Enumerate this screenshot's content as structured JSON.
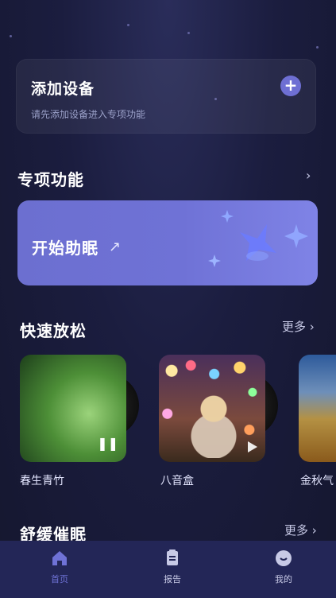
{
  "colors": {
    "background": "#1b1d3f",
    "accent": "#6e6fd3",
    "tabbar": "#232657",
    "tab_active": "#6f72d6",
    "tab_inactive": "#c7c9e6"
  },
  "device_card": {
    "title": "添加设备",
    "subtitle": "请先添加设备进入专项功能",
    "plus_icon": "plus-icon"
  },
  "special": {
    "title": "专项功能",
    "chevron_icon": "chevron-right-icon",
    "banner": {
      "label": "开始助眠",
      "arrow_icon": "arrow-right-icon"
    }
  },
  "quick_relax": {
    "title": "快速放松",
    "more": "更多 ›",
    "items": [
      {
        "name": "春生青竹",
        "control_icon": "pause-icon"
      },
      {
        "name": "八音盒",
        "control_icon": "play-icon"
      },
      {
        "name": "金秋气",
        "control_icon": ""
      }
    ]
  },
  "hypnosis": {
    "title": "舒缓催眠",
    "more": "更多 ›"
  },
  "tabs": [
    {
      "label": "首页",
      "icon": "home-icon",
      "active": true
    },
    {
      "label": "报告",
      "icon": "report-icon",
      "active": false
    },
    {
      "label": "我的",
      "icon": "profile-icon",
      "active": false
    }
  ]
}
